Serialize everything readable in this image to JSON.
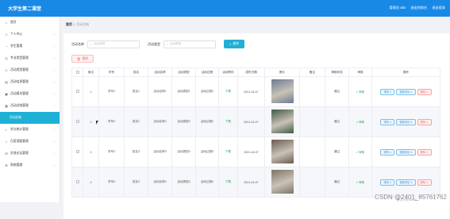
{
  "header": {
    "title": "大学生第二课堂",
    "links": [
      "管理员 abo",
      "退出到前台",
      "退出登录"
    ]
  },
  "sidebar": {
    "items": [
      {
        "icon": "home-icon",
        "label": "首页"
      },
      {
        "icon": "user-icon",
        "label": "个人中心",
        "chevron": "⌄"
      },
      {
        "icon": "student-icon",
        "label": "学生管理",
        "chevron": "⌄"
      },
      {
        "icon": "teacher-icon",
        "label": "专业类型管理",
        "chevron": "⌄"
      },
      {
        "icon": "activity-icon",
        "label": "活动类型管理",
        "chevron": "⌄"
      },
      {
        "icon": "activity-info-icon",
        "label": "活动信息管理",
        "chevron": "⌄"
      },
      {
        "icon": "signup-icon",
        "label": "活动报名管理",
        "chevron": "⌄"
      },
      {
        "icon": "summary-icon",
        "label": "活动总结管理",
        "chevron": "⌄"
      }
    ],
    "active_sub": "活动总结",
    "items_after": [
      {
        "icon": "score-icon",
        "label": "学分统计管理",
        "chevron": "⌄"
      },
      {
        "icon": "award-icon",
        "label": "日奖项配管理",
        "chevron": "⌄"
      },
      {
        "icon": "forum-icon",
        "label": "交流论坛管理",
        "chevron": "⌄"
      },
      {
        "icon": "settings-icon",
        "label": "系统管理",
        "chevron": "⌄"
      }
    ]
  },
  "breadcrumb": {
    "home": "首页",
    "sep": "/",
    "current": "活动总结"
  },
  "search": {
    "label1": "活动名称",
    "placeholder1": "活动名称",
    "label2": "活动类型",
    "placeholder2": "活动类型",
    "query_button": "查询"
  },
  "toolbar": {
    "delete_label": "删除"
  },
  "table": {
    "headers": [
      "",
      "索引",
      "学号",
      "姓名",
      "活动名称",
      "活动类型",
      "活动过程",
      "活动附件",
      "发布日期",
      "照片",
      "备注",
      "审核状态",
      "审核",
      "操作"
    ],
    "rows": [
      {
        "index": "1",
        "xuehao": "学号1",
        "name": "姓名1",
        "act_name": "活动名称1",
        "act_type": "活动类型1",
        "process": "活动过程1",
        "attach": "下载",
        "date": "2021-04-07",
        "note": "",
        "audit_status": "通过",
        "audit": "审核",
        "photo_color": "#6b7b92"
      },
      {
        "index": "2",
        "xuehao": "学号2",
        "name": "姓名2",
        "act_name": "活动名称2",
        "act_type": "活动类型2",
        "process": "活动过程2",
        "attach": "下载",
        "date": "2021-04-07",
        "note": "",
        "audit_status": "通过",
        "audit": "审核",
        "photo_color": "#3f5a46"
      },
      {
        "index": "3",
        "xuehao": "学号3",
        "name": "姓名3",
        "act_name": "活动名称3",
        "act_type": "活动类型3",
        "process": "活动过程3",
        "attach": "下载",
        "date": "2021-04-07",
        "note": "",
        "audit_status": "通过",
        "audit": "审核",
        "photo_color": "#6a5a4e"
      },
      {
        "index": "4",
        "xuehao": "学号4",
        "name": "姓名4",
        "act_name": "活动名称4",
        "act_type": "活动类型4",
        "process": "活动过程4",
        "attach": "下载",
        "date": "2021-04-07",
        "note": "",
        "audit_status": "通过",
        "audit": "审核",
        "photo_color": "#7c7466"
      }
    ],
    "op_detail": "详情",
    "op_review": "查看评论",
    "op_delete": "删除"
  },
  "watermark": "CSDN @2401_85761762",
  "activate": "激活 Windows"
}
